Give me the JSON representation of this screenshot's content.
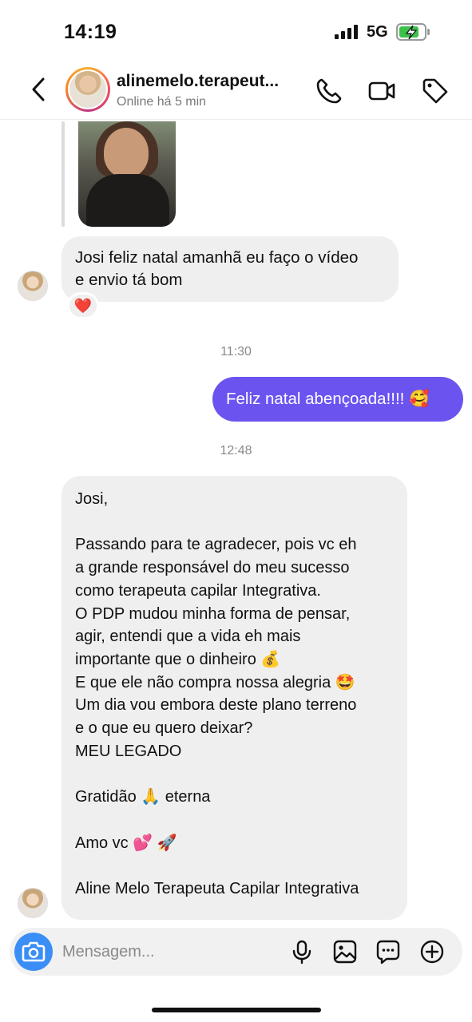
{
  "status_bar": {
    "time": "14:19",
    "network": "5G"
  },
  "header": {
    "contact_name": "alinemelo.terapeut...",
    "contact_status": "Online há 5 min"
  },
  "messages": [
    {
      "sender": "contact",
      "text": "Josi feliz natal amanhã eu faço o vídeo\ne envio tá bom",
      "reaction": "❤️"
    },
    {
      "timestamp": "11:30"
    },
    {
      "sender": "me",
      "text": "Feliz natal abençoada!!!! 🥰"
    },
    {
      "timestamp": "12:48"
    },
    {
      "sender": "contact",
      "text": "Josi,\n\nPassando para te agradecer, pois vc eh\na grande responsável do meu sucesso\ncomo terapeuta capilar Integrativa.\nO PDP mudou minha forma de pensar,\nagir, entendi que a vida eh mais\nimportante que o dinheiro 💰\nE que ele não compra nossa alegria 🤩\nUm dia vou embora deste plano terreno\ne o que eu quero deixar?\nMEU LEGADO\n\nGratidão 🙏 eterna\n\nAmo vc 💕 🚀\n\nAline Melo Terapeuta Capilar Integrativa"
    }
  ],
  "composer": {
    "placeholder": "Mensagem..."
  },
  "colors": {
    "outgoing_bubble": "#6b53f0",
    "incoming_bubble": "#efefef",
    "camera_button": "#3a8ef6"
  },
  "icons": [
    "back-icon",
    "phone-icon",
    "video-call-icon",
    "tag-icon",
    "camera-icon",
    "microphone-icon",
    "gallery-icon",
    "sticker-icon",
    "plus-icon",
    "heart-icon"
  ]
}
